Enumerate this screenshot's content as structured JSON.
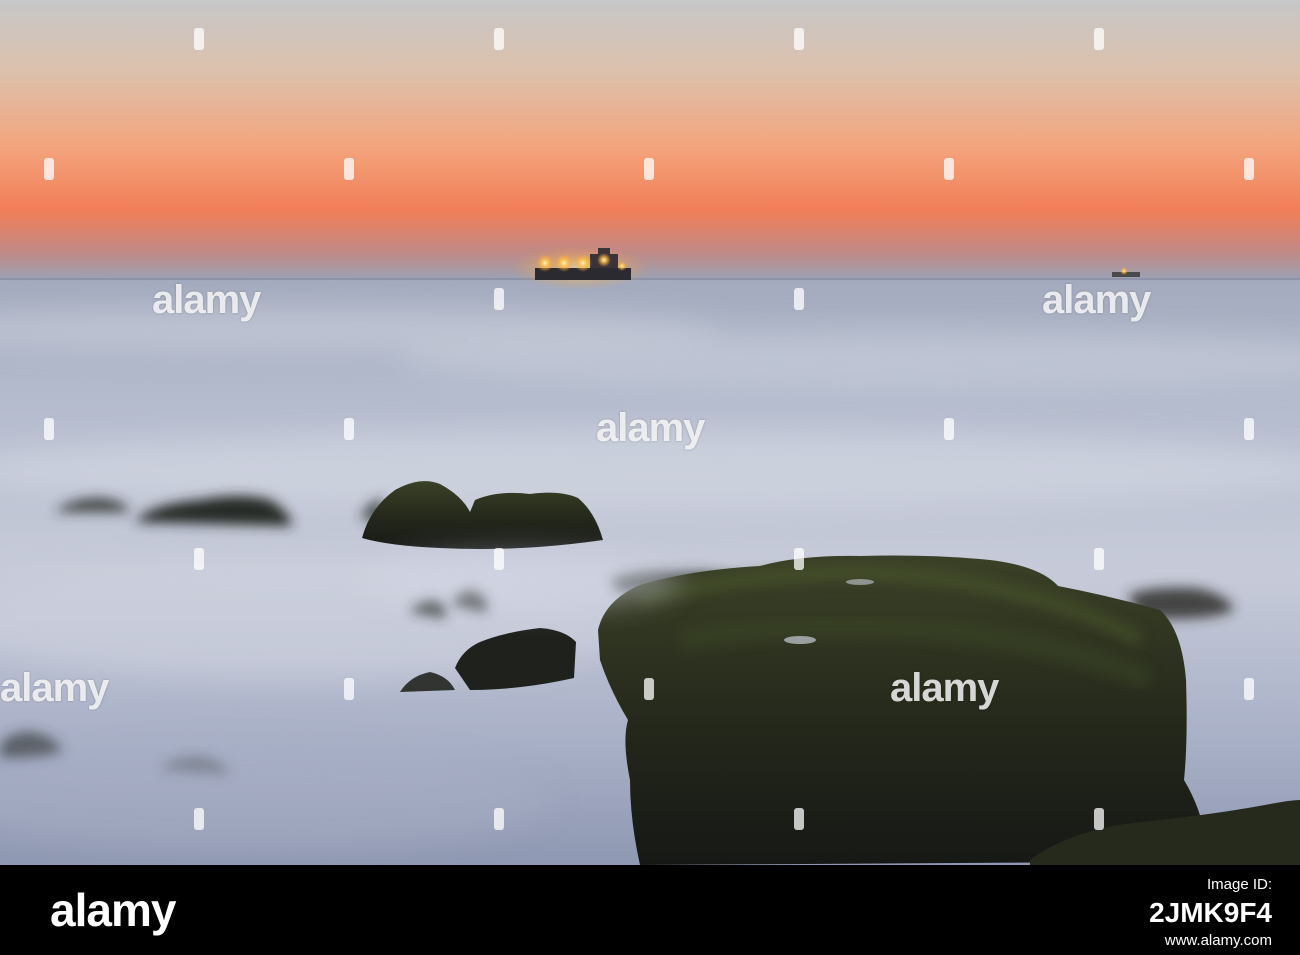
{
  "watermark": {
    "text": "alamy"
  },
  "footer": {
    "logo": "alamy",
    "label": "Image ID:",
    "image_id": "2JMK9F4",
    "site": "www.alamy.com"
  },
  "colors": {
    "sky_top": "#c4c6c8",
    "sky_glow": "#f27f56",
    "sea": "#9ea6bd",
    "rock": "#1b1e18",
    "moss": "#3a4024"
  }
}
